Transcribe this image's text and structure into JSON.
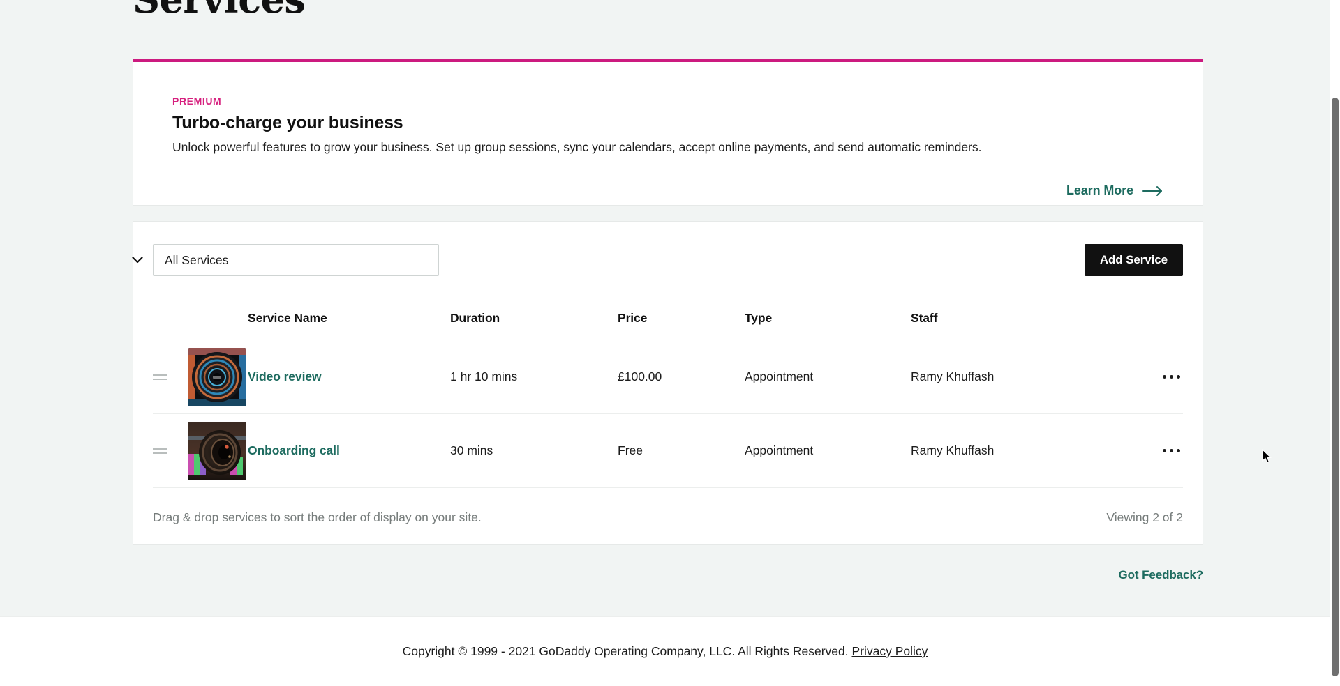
{
  "page": {
    "title": "Services"
  },
  "banner": {
    "eyebrow": "PREMIUM",
    "title": "Turbo-charge your business",
    "description": "Unlock powerful features to grow your business. Set up group sessions, sync your calendars, accept online payments, and send automatic reminders.",
    "cta_label": "Learn More",
    "cta_icon": "arrow-right-icon",
    "accent_color": "#cc1a7f",
    "eyebrow_color": "#d6207e"
  },
  "toolbar": {
    "filter_selected": "All Services",
    "filter_options": [
      "All Services"
    ],
    "filter_icon": "chevron-down-icon",
    "add_service_label": "Add Service"
  },
  "table": {
    "columns": [
      "Service Name",
      "Duration",
      "Price",
      "Type",
      "Staff"
    ],
    "rows": [
      {
        "drag_handle_icon": "drag-handle-icon",
        "thumbnail_icon": "camera-lens-thumbnail",
        "name": "Video review",
        "duration": "1 hr 10 mins",
        "price": "£100.00",
        "type": "Appointment",
        "staff": "Ramy Khuffash",
        "menu_icon": "kebab-menu-icon"
      },
      {
        "drag_handle_icon": "drag-handle-icon",
        "thumbnail_icon": "camera-lens-thumbnail",
        "name": "Onboarding call",
        "duration": "30 mins",
        "price": "Free",
        "type": "Appointment",
        "staff": "Ramy Khuffash",
        "menu_icon": "kebab-menu-icon"
      }
    ],
    "hint": "Drag & drop services to sort the order of display on your site.",
    "viewing": "Viewing 2 of 2"
  },
  "feedback": {
    "label": "Got Feedback?"
  },
  "footer": {
    "copyright": "Copyright © 1999 - 2021 GoDaddy Operating Company, LLC. All Rights Reserved.",
    "privacy_label": "Privacy Policy"
  },
  "colors": {
    "page_background": "#f1f4f3",
    "link_teal": "#1d6b5f",
    "button_black": "#111111",
    "premium_magenta": "#cc1a7f"
  }
}
